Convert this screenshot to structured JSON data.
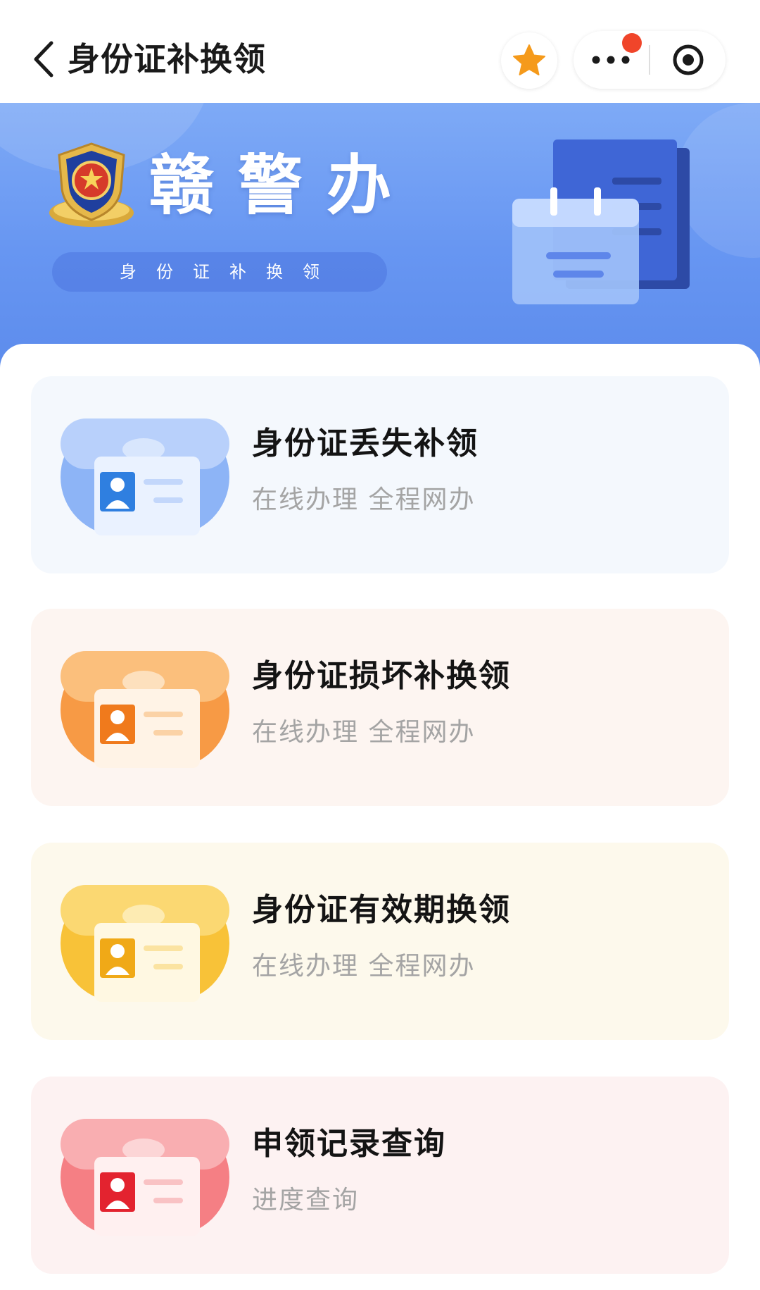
{
  "nav": {
    "title": "身份证补换领",
    "back_icon": "chevron-left-icon",
    "favorite_icon": "star-icon",
    "more_icon": "more-dots-icon",
    "close_icon": "target-close-icon",
    "favorite_color": "#f59a1b",
    "notification_dot_color": "#f0452a"
  },
  "banner": {
    "brand": "赣警办",
    "subtitle": "身份证补换领",
    "badge_icon": "police-badge-icon",
    "illustration_icon": "calendar-document-icon"
  },
  "services": [
    {
      "title": "身份证丢失补领",
      "subtitle": "在线办理  全程网办",
      "theme": "blue",
      "icon": "id-card-icon",
      "accent": "#6f9cf2"
    },
    {
      "title": "身份证损坏补换领",
      "subtitle": "在线办理  全程网办",
      "theme": "orange",
      "icon": "id-card-icon",
      "accent": "#f58a2c"
    },
    {
      "title": "身份证有效期换领",
      "subtitle": "在线办理  全程网办",
      "theme": "yellow",
      "icon": "id-card-icon",
      "accent": "#f5b71b"
    },
    {
      "title": "申领记录查询",
      "subtitle": "进度查询",
      "theme": "red",
      "icon": "id-card-icon",
      "accent": "#ef5a5a"
    }
  ]
}
